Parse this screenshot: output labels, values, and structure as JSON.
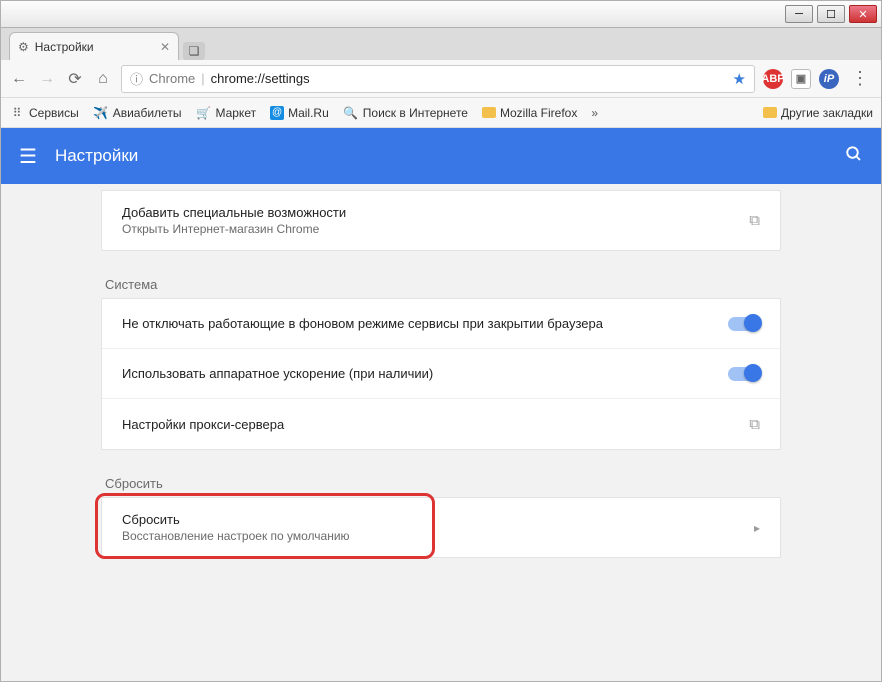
{
  "window": {
    "tab_title": "Настройки"
  },
  "addressbar": {
    "protocol_label": "Chrome",
    "url": "chrome://settings"
  },
  "bookmarks": {
    "services": "Сервисы",
    "avia": "Авиабилеты",
    "market": "Маркет",
    "mailru": "Mail.Ru",
    "search": "Поиск в Интернете",
    "mozilla": "Mozilla Firefox",
    "more": "»",
    "other": "Другие закладки"
  },
  "header": {
    "title": "Настройки"
  },
  "accessibility": {
    "title": "Добавить специальные возможности",
    "sub": "Открыть Интернет-магазин Chrome"
  },
  "system": {
    "heading": "Система",
    "bg_label": "Не отключать работающие в фоновом режиме сервисы при закрытии браузера",
    "hw_label": "Использовать аппаратное ускорение (при наличии)",
    "proxy_label": "Настройки прокси-сервера"
  },
  "reset": {
    "heading": "Сбросить",
    "title": "Сбросить",
    "sub": "Восстановление настроек по умолчанию"
  }
}
